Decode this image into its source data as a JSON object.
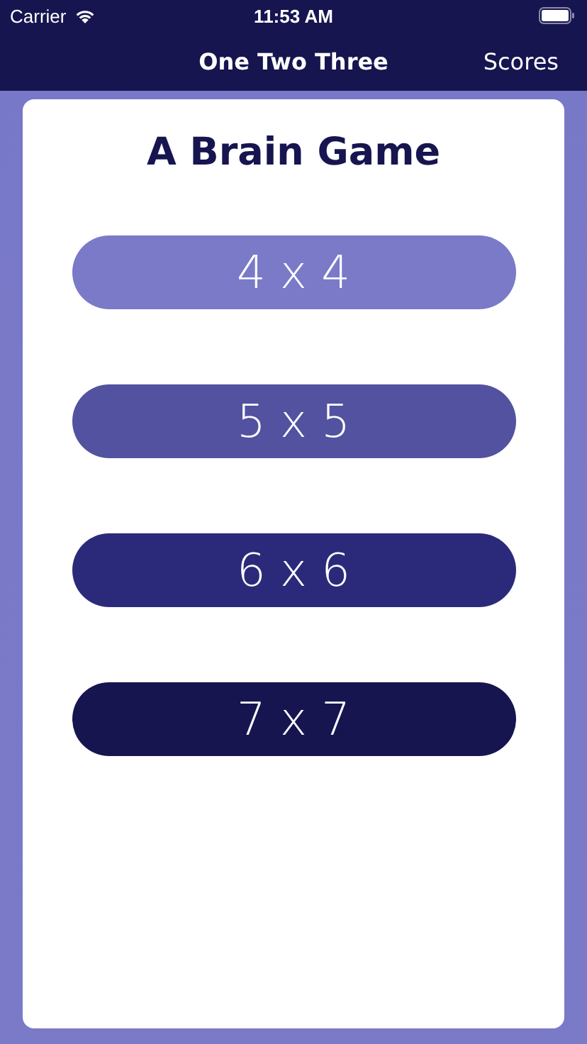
{
  "status_bar": {
    "carrier": "Carrier",
    "time": "11:53 AM"
  },
  "nav_bar": {
    "title": "One Two Three",
    "right_button": "Scores"
  },
  "card": {
    "title": "A Brain Game",
    "buttons": [
      {
        "label": "4 x 4",
        "color": "#7a7ac8"
      },
      {
        "label": "5 x 5",
        "color": "#5252a0"
      },
      {
        "label": "6 x 6",
        "color": "#2b2a7a"
      },
      {
        "label": "7 x 7",
        "color": "#161550"
      }
    ]
  }
}
